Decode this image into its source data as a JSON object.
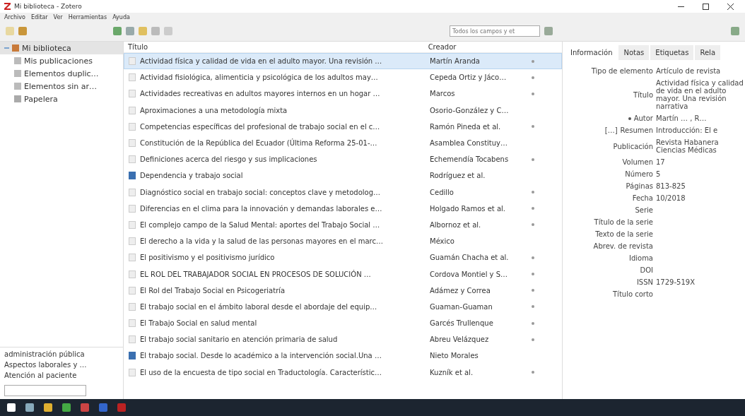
{
  "window": {
    "title": "Mi biblioteca - Zotero"
  },
  "menu": [
    "Archivo",
    "Editar",
    "Ver",
    "Herramientas",
    "Ayuda"
  ],
  "search": {
    "placeholder": "Todos los campos y et"
  },
  "collections": [
    {
      "label": "Mi biblioteca",
      "kind": "library",
      "selected": true,
      "expanded": true,
      "children": [
        {
          "label": "Mis publicaciones",
          "kind": "publications",
          "selected": false
        },
        {
          "label": "Elementos duplic…",
          "kind": "duplicates",
          "selected": false
        },
        {
          "label": "Elementos sin ar…",
          "kind": "unfiled",
          "selected": false
        },
        {
          "label": "Papelera",
          "kind": "trash",
          "selected": false
        }
      ]
    }
  ],
  "tags": [
    "administración pública",
    "Aspectos laborales y …",
    "Atención al paciente"
  ],
  "table": {
    "columns": [
      "Título",
      "Creador"
    ],
    "rows": [
      {
        "title": "Actividad física y calidad de vida en el adulto mayor. Una revisión …",
        "creator": "Martín Aranda",
        "kind": "article",
        "attachment": true,
        "selected": true
      },
      {
        "title": "Actividad fisiológica, alimenticia y psicológica de los adultos may…",
        "creator": "Cepeda Ortiz y Jáco…",
        "kind": "article",
        "attachment": true,
        "selected": false
      },
      {
        "title": "Actividades recreativas en adultos mayores internos en un hogar …",
        "creator": "Marcos",
        "kind": "article",
        "attachment": true,
        "selected": false
      },
      {
        "title": "Aproximaciones a una metodología mixta",
        "creator": "Osorio-González y C…",
        "kind": "article",
        "attachment": false,
        "selected": false
      },
      {
        "title": "Competencias específicas del profesional de trabajo social en el c…",
        "creator": "Ramón Pineda et al.",
        "kind": "article",
        "attachment": true,
        "selected": false
      },
      {
        "title": "Constitución de la República del Ecuador (Última Reforma 25-01-…",
        "creator": "Asamblea Constituy…",
        "kind": "article",
        "attachment": false,
        "selected": false
      },
      {
        "title": "Definiciones acerca del riesgo y sus implicaciones",
        "creator": "Echemendía Tocabens",
        "kind": "article",
        "attachment": true,
        "selected": false
      },
      {
        "title": "Dependencia y trabajo social",
        "creator": "Rodríguez et al.",
        "kind": "book",
        "attachment": false,
        "selected": false
      },
      {
        "title": "Diagnóstico social en trabajo social: conceptos clave y metodolog…",
        "creator": "Cedillo",
        "kind": "article",
        "attachment": true,
        "selected": false
      },
      {
        "title": "Diferencias en el clima para la innovación y demandas laborales e…",
        "creator": "Holgado Ramos et al.",
        "kind": "article",
        "attachment": true,
        "selected": false
      },
      {
        "title": "El complejo campo de la Salud Mental: aportes del Trabajo Social …",
        "creator": "Albornoz et al.",
        "kind": "article",
        "attachment": true,
        "selected": false
      },
      {
        "title": "El derecho a la vida y la salud de las personas mayores en el marc…",
        "creator": "México",
        "kind": "article",
        "attachment": false,
        "selected": false
      },
      {
        "title": "El positivismo y el positivismo jurídico",
        "creator": "Guamán Chacha et al.",
        "kind": "article",
        "attachment": true,
        "selected": false
      },
      {
        "title": "EL ROL DEL TRABAJADOR SOCIAL EN PROCESOS DE SOLUCIÓN …",
        "creator": "Cordova Montiel y S…",
        "kind": "article",
        "attachment": true,
        "selected": false
      },
      {
        "title": "El Rol del Trabajo Social en Psicogeriatría",
        "creator": "Adámez y Correa",
        "kind": "article",
        "attachment": true,
        "selected": false
      },
      {
        "title": "El trabajo social en el ámbito laboral desde el abordaje del equip…",
        "creator": "Guaman-Guaman",
        "kind": "article",
        "attachment": true,
        "selected": false
      },
      {
        "title": "El Trabajo Social en salud mental",
        "creator": "Garcés Trullenque",
        "kind": "article",
        "attachment": true,
        "selected": false
      },
      {
        "title": "El trabajo social sanitario en atención primaria de salud",
        "creator": "Abreu Velázquez",
        "kind": "article",
        "attachment": true,
        "selected": false
      },
      {
        "title": "El trabajo social. Desde lo académico a la intervención social.Una …",
        "creator": "Nieto Morales",
        "kind": "book",
        "attachment": false,
        "selected": false
      },
      {
        "title": "El uso de la encuesta de tipo social en Traductología. Característic…",
        "creator": "Kuzník et al.",
        "kind": "article",
        "attachment": true,
        "selected": false
      }
    ]
  },
  "info_tabs": [
    {
      "label": "Información",
      "selected": true
    },
    {
      "label": "Notas",
      "selected": false
    },
    {
      "label": "Etiquetas",
      "selected": false
    },
    {
      "label": "Rela",
      "selected": false
    }
  ],
  "fields": [
    {
      "label": "Tipo de elemento",
      "value": "Artículo de revista"
    },
    {
      "label": "Título",
      "value": "Actividad física y calidad de vida en el adulto mayor. Una revisión narrativa"
    },
    {
      "label": "Autor",
      "value": "Martín … , R…",
      "kind": "creator"
    },
    {
      "label": "Resumen",
      "value": "Introducción: El e",
      "kind": "abstract",
      "toggle": "[…]"
    },
    {
      "label": "Publicación",
      "value": "Revista Habanera Ciencias Médicas"
    },
    {
      "label": "Volumen",
      "value": "17"
    },
    {
      "label": "Número",
      "value": "5"
    },
    {
      "label": "Páginas",
      "value": "813-825"
    },
    {
      "label": "Fecha",
      "value": "10/2018"
    },
    {
      "label": "Serie"
    },
    {
      "label": "Título de la serie"
    },
    {
      "label": "Texto de la serie"
    },
    {
      "label": "Abrev. de revista"
    },
    {
      "label": "Idioma"
    },
    {
      "label": "DOI"
    },
    {
      "label": "ISSN",
      "value": "1729-519X"
    },
    {
      "label": "Título corto"
    }
  ]
}
